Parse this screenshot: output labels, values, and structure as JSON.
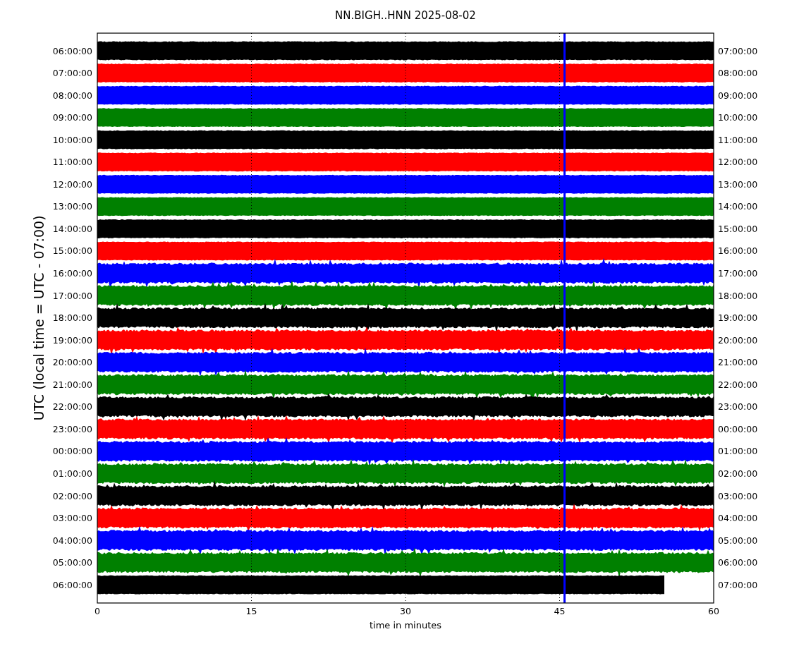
{
  "title": "NN.BIGH..HNN 2025-08-02",
  "ylabel": "UTC (local time = UTC - 07:00)",
  "xlabel": "time in minutes",
  "xticks": [
    "0",
    "15",
    "30",
    "45",
    "60"
  ],
  "rows": [
    {
      "left": "06:00:00",
      "right": "07:00:00",
      "color": "#000000",
      "level": 1
    },
    {
      "left": "07:00:00",
      "right": "08:00:00",
      "color": "#ff0000",
      "level": 1
    },
    {
      "left": "08:00:00",
      "right": "09:00:00",
      "color": "#0000ff",
      "level": 1
    },
    {
      "left": "09:00:00",
      "right": "10:00:00",
      "color": "#008000",
      "level": 1
    },
    {
      "left": "10:00:00",
      "right": "11:00:00",
      "color": "#000000",
      "level": 1
    },
    {
      "left": "11:00:00",
      "right": "12:00:00",
      "color": "#ff0000",
      "level": 1
    },
    {
      "left": "12:00:00",
      "right": "13:00:00",
      "color": "#0000ff",
      "level": 1
    },
    {
      "left": "13:00:00",
      "right": "14:00:00",
      "color": "#008000",
      "level": 1
    },
    {
      "left": "14:00:00",
      "right": "15:00:00",
      "color": "#000000",
      "level": 1
    },
    {
      "left": "15:00:00",
      "right": "16:00:00",
      "color": "#ff0000",
      "level": 1
    },
    {
      "left": "16:00:00",
      "right": "17:00:00",
      "color": "#0000ff",
      "level": 1
    },
    {
      "left": "17:00:00",
      "right": "18:00:00",
      "color": "#008000",
      "level": 1
    },
    {
      "left": "18:00:00",
      "right": "19:00:00",
      "color": "#000000",
      "level": 1
    },
    {
      "left": "19:00:00",
      "right": "20:00:00",
      "color": "#ff0000",
      "level": 1
    },
    {
      "left": "20:00:00",
      "right": "21:00:00",
      "color": "#0000ff",
      "level": 1
    },
    {
      "left": "21:00:00",
      "right": "22:00:00",
      "color": "#008000",
      "level": 1
    },
    {
      "left": "22:00:00",
      "right": "23:00:00",
      "color": "#000000",
      "level": 1
    },
    {
      "left": "23:00:00",
      "right": "00:00:00",
      "color": "#ff0000",
      "level": 1
    },
    {
      "left": "00:00:00",
      "right": "01:00:00",
      "color": "#0000ff",
      "level": 1
    },
    {
      "left": "01:00:00",
      "right": "02:00:00",
      "color": "#008000",
      "level": 1
    },
    {
      "left": "02:00:00",
      "right": "03:00:00",
      "color": "#000000",
      "level": 1
    },
    {
      "left": "03:00:00",
      "right": "04:00:00",
      "color": "#ff0000",
      "level": 1
    },
    {
      "left": "04:00:00",
      "right": "05:00:00",
      "color": "#0000ff",
      "level": 1
    },
    {
      "left": "05:00:00",
      "right": "06:00:00",
      "color": "#008000",
      "level": 1
    },
    {
      "left": "06:00:00",
      "right": "07:00:00",
      "color": "#000000",
      "level": 0.92
    }
  ]
}
